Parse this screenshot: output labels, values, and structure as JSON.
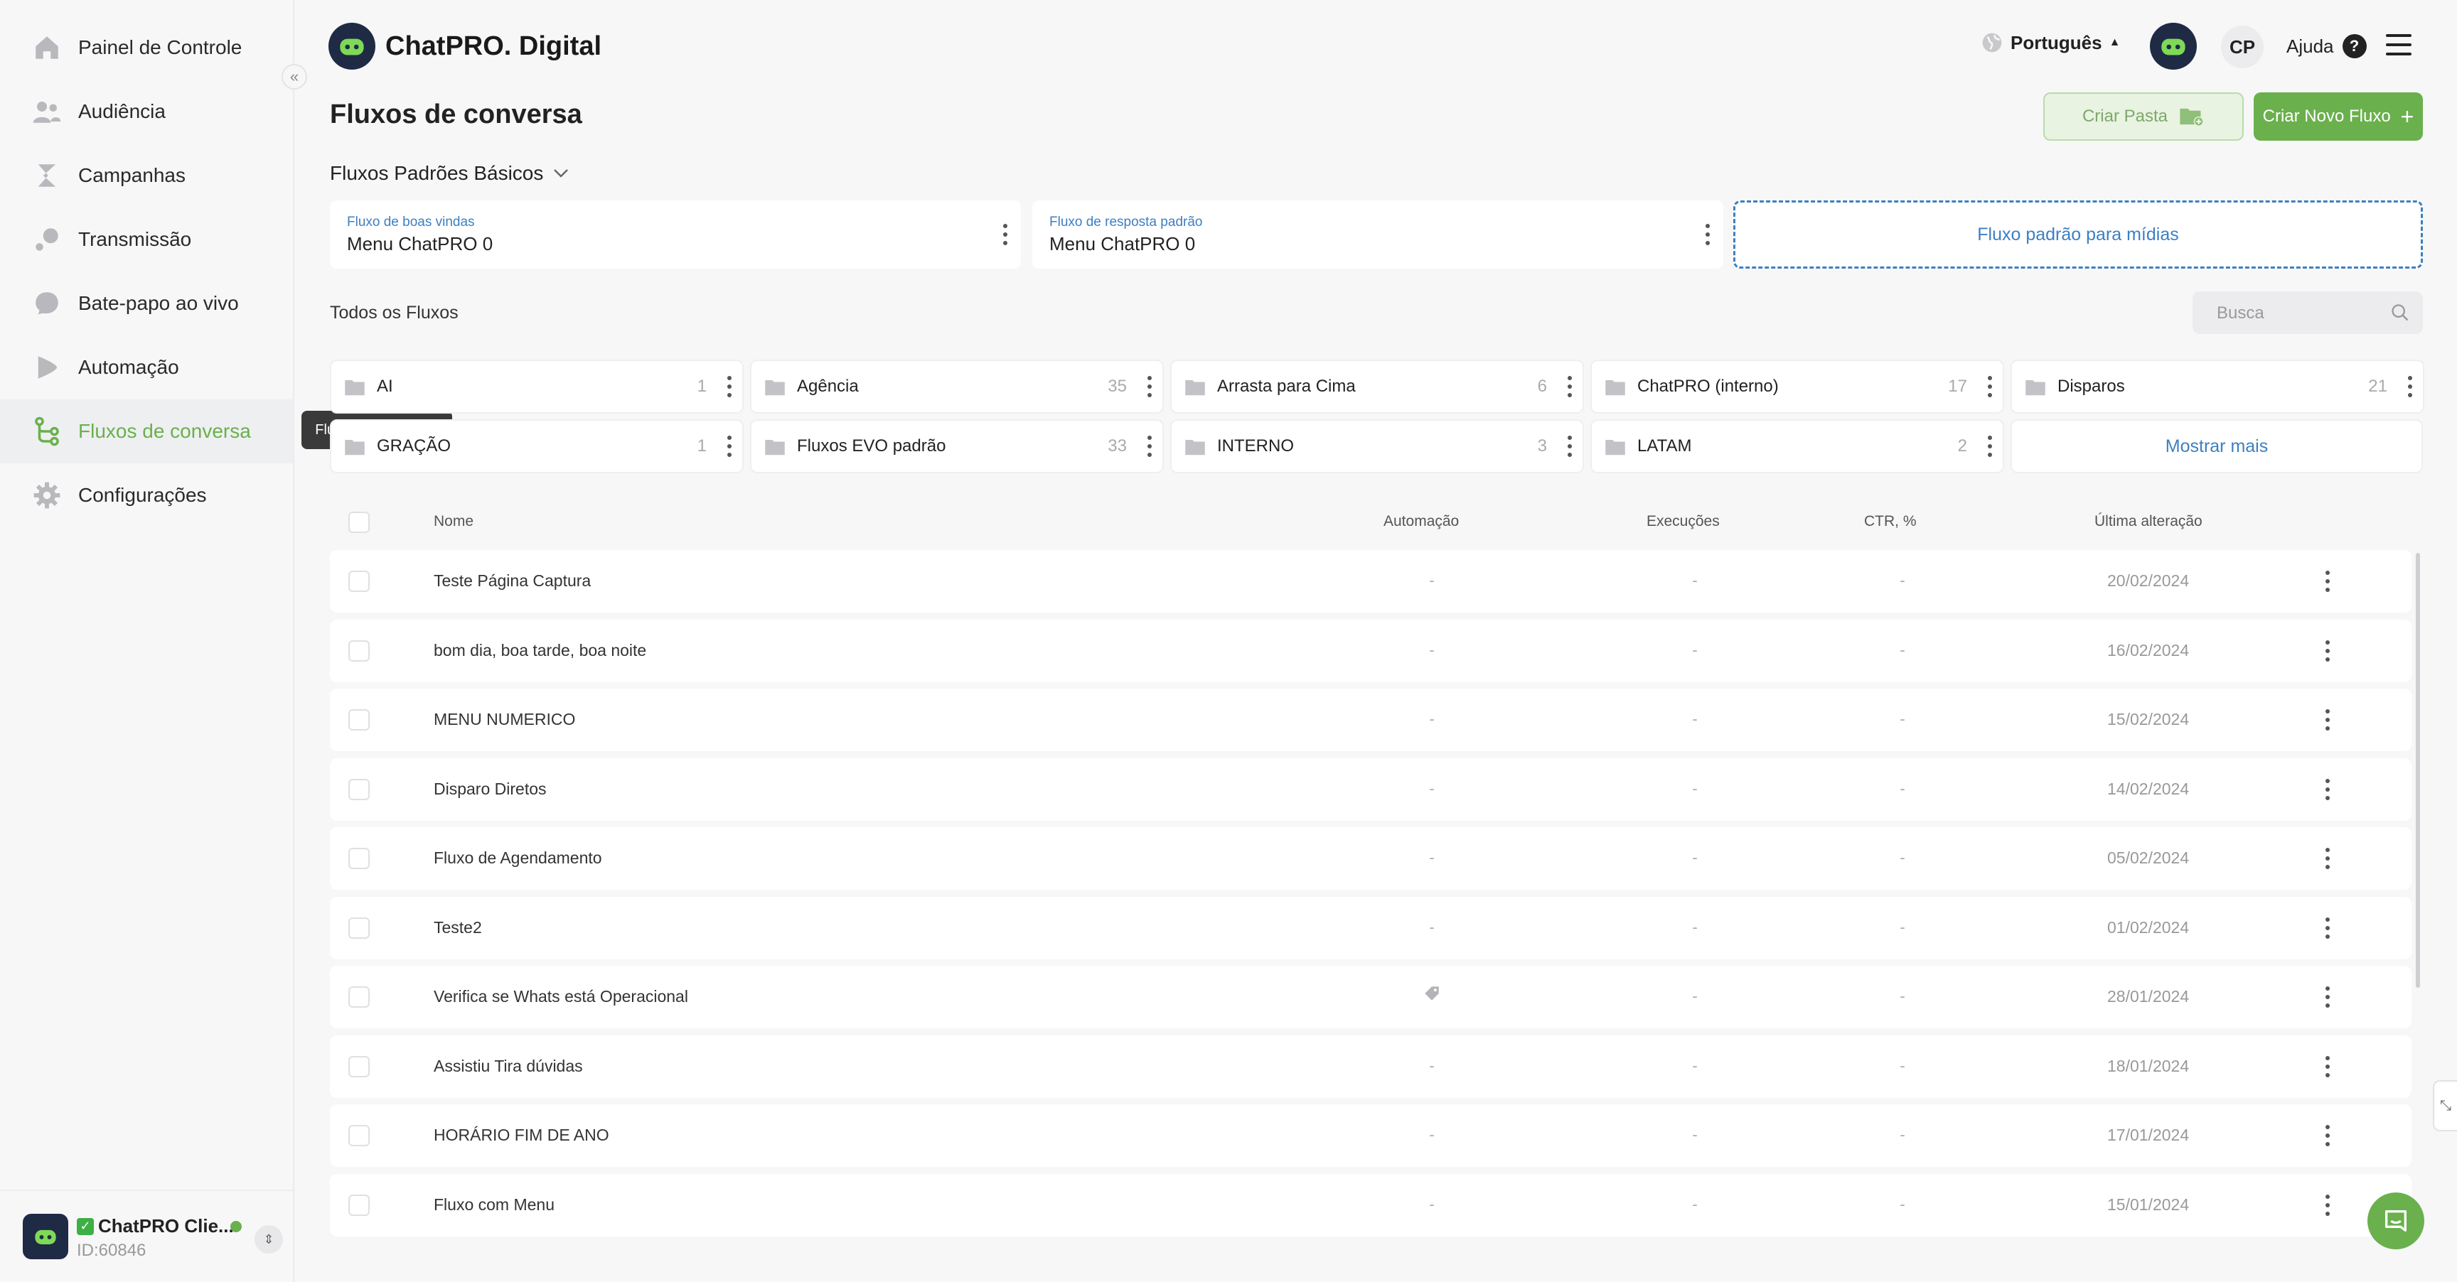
{
  "sidebar": {
    "items": [
      {
        "label": "Painel de Controle",
        "icon": "home-icon"
      },
      {
        "label": "Audiência",
        "icon": "users-icon"
      },
      {
        "label": "Campanhas",
        "icon": "campaign-icon"
      },
      {
        "label": "Transmissão",
        "icon": "broadcast-icon"
      },
      {
        "label": "Bate-papo ao vivo",
        "icon": "chat-bubble-icon"
      },
      {
        "label": "Automação",
        "icon": "automation-icon"
      },
      {
        "label": "Fluxos de conversa",
        "icon": "flow-icon",
        "active": true
      },
      {
        "label": "Configurações",
        "icon": "gear-icon"
      }
    ],
    "tooltip": "Fluxos de conversa",
    "account": {
      "name": "ChatPRO Clie...",
      "id": "ID:60846"
    }
  },
  "header": {
    "brand": "ChatPRO. Digital",
    "language": "Português",
    "user_initials": "CP",
    "help": "Ajuda"
  },
  "page": {
    "title": "Fluxos de conversa",
    "create_folder": "Criar Pasta",
    "create_flow": "Criar Novo Fluxo",
    "basic_section": "Fluxos Padrões Básicos",
    "default_flows": [
      {
        "label": "Fluxo de boas vindas",
        "value": "Menu ChatPRO 0"
      },
      {
        "label": "Fluxo de resposta padrão",
        "value": "Menu ChatPRO 0"
      }
    ],
    "media_flow": "Fluxo padrão para mídias",
    "all_flows": "Todos os Fluxos",
    "search_placeholder": "Busca",
    "show_more": "Mostrar mais"
  },
  "folders": [
    {
      "name": "AI",
      "count": "1"
    },
    {
      "name": "Agência",
      "count": "35"
    },
    {
      "name": "Arrasta para Cima",
      "count": "6"
    },
    {
      "name": "ChatPRO (interno)",
      "count": "17"
    },
    {
      "name": "Disparos",
      "count": "21"
    },
    {
      "name": "GRAÇÃO",
      "count": "1"
    },
    {
      "name": "Fluxos EVO padrão",
      "count": "33"
    },
    {
      "name": "INTERNO",
      "count": "3"
    },
    {
      "name": "LATAM",
      "count": "2"
    }
  ],
  "table": {
    "columns": {
      "name": "Nome",
      "automation": "Automação",
      "executions": "Execuções",
      "ctr": "CTR, %",
      "last_change": "Última alteração"
    },
    "rows": [
      {
        "name": "Teste Página Captura",
        "automation": "-",
        "executions": "-",
        "ctr": "-",
        "date": "20/02/2024"
      },
      {
        "name": "bom dia, boa tarde, boa noite",
        "automation": "-",
        "executions": "-",
        "ctr": "-",
        "date": "16/02/2024"
      },
      {
        "name": "MENU NUMERICO",
        "automation": "-",
        "executions": "-",
        "ctr": "-",
        "date": "15/02/2024"
      },
      {
        "name": "Disparo Diretos",
        "automation": "-",
        "executions": "-",
        "ctr": "-",
        "date": "14/02/2024"
      },
      {
        "name": "Fluxo de Agendamento",
        "automation": "-",
        "executions": "-",
        "ctr": "-",
        "date": "05/02/2024"
      },
      {
        "name": "Teste2",
        "automation": "-",
        "executions": "-",
        "ctr": "-",
        "date": "01/02/2024"
      },
      {
        "name": "Verifica se Whats está Operacional",
        "automation": "tag-icon",
        "executions": "-",
        "ctr": "-",
        "date": "28/01/2024"
      },
      {
        "name": "Assistiu Tira dúvidas",
        "automation": "-",
        "executions": "-",
        "ctr": "-",
        "date": "18/01/2024"
      },
      {
        "name": "HORÁRIO FIM DE ANO",
        "automation": "-",
        "executions": "-",
        "ctr": "-",
        "date": "17/01/2024"
      },
      {
        "name": "Fluxo com Menu",
        "automation": "-",
        "executions": "-",
        "ctr": "-",
        "date": "15/01/2024"
      }
    ]
  },
  "colors": {
    "accent_green": "#6ab04c",
    "link_blue": "#3d7fc2",
    "brand_dark": "#1f2a44"
  }
}
